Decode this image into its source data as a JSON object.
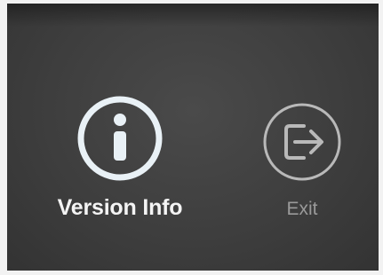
{
  "menu": {
    "items": [
      {
        "label": "Version Info",
        "icon": "info-icon",
        "state": "selected",
        "color": "#f4f4f4"
      },
      {
        "label": "Exit",
        "icon": "exit-icon",
        "state": "unselected",
        "color": "#9a9a9a"
      }
    ]
  }
}
